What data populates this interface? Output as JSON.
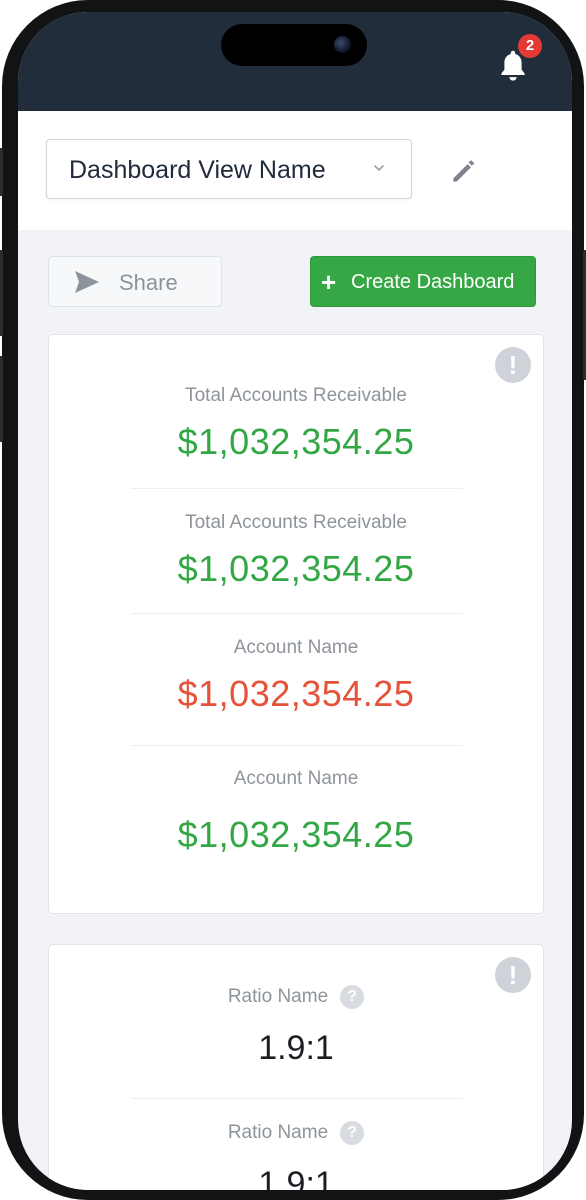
{
  "notifications": {
    "icon": "bell-icon",
    "count": "2",
    "badge_color": "#e53935"
  },
  "header": {
    "dashboard_view_name": "Dashboard View Name",
    "dropdown_icon": "chevron-down-icon",
    "edit_icon": "pencil-icon"
  },
  "actions": {
    "share_label": "Share",
    "share_icon": "send-icon",
    "create_label": "Create Dashboard",
    "create_icon": "+"
  },
  "card1": {
    "info_glyph": "!",
    "metrics": [
      {
        "label": "Total Accounts Receivable",
        "value": "$1,032,354.25",
        "status": "positive"
      },
      {
        "label": "Total Accounts Receivable",
        "value": "$1,032,354.25",
        "status": "positive"
      },
      {
        "label": "Account Name",
        "value": "$1,032,354.25",
        "status": "negative"
      },
      {
        "label": "Account Name",
        "value": "$1,032,354.25",
        "status": "positive"
      }
    ]
  },
  "card2": {
    "info_glyph": "!",
    "help_glyph": "?",
    "ratios": [
      {
        "label": "Ratio Name",
        "value": "1.9:1"
      },
      {
        "label": "Ratio Name",
        "value": "1.9:1"
      }
    ]
  },
  "colors": {
    "status_bar": "#222d3b",
    "positive": "#33a744",
    "negative": "#e6523a",
    "primary_button": "#35a845"
  }
}
